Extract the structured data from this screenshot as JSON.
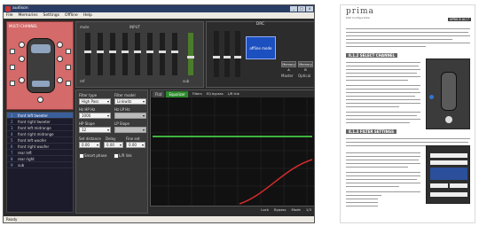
{
  "app": {
    "title": "audison",
    "menu": [
      "File",
      "Memories",
      "Settings",
      "Offline",
      "Help"
    ],
    "winbtns": [
      "_",
      "□",
      "x"
    ],
    "carpanel_header": "MULTI CHANNEL",
    "status": "Ready",
    "channels": [
      {
        "num": "1",
        "label": "front left tweeter"
      },
      {
        "num": "2",
        "label": "front right tweeter"
      },
      {
        "num": "3",
        "label": "front left midrange"
      },
      {
        "num": "4",
        "label": "front right midrange"
      },
      {
        "num": "5",
        "label": "front left woofer"
      },
      {
        "num": "6",
        "label": "front right woofer"
      },
      {
        "num": "7",
        "label": "rear left"
      },
      {
        "num": "8",
        "label": "rear right"
      },
      {
        "num": "9",
        "label": "sub"
      }
    ],
    "top": {
      "mute_label": "mute",
      "input_label": "INPUT",
      "sub_label": "sub",
      "ref_label": "ref",
      "mute2_label": "mute"
    },
    "dsp": {
      "title": "DRC",
      "screen_text": "offline mode",
      "memory_a": "Memory A",
      "memory_b": "Memory B",
      "master_label": "Master",
      "optical_label": "Optical"
    },
    "filters": {
      "filter_type_label": "Filter type",
      "filter_type_value": "High Pass",
      "filter_model_label": "Filter model",
      "filter_model_value": "Linkwitz",
      "hp_freq_label": "Hz HP Hz",
      "hp_freq_value": "1000",
      "lp_freq_label": "Hz LP Hz",
      "hp_slope_label": "HP Slope",
      "hp_slope_value": "12",
      "lp_slope_label": "LP Slope",
      "set_distance_label": "Set distance",
      "delay_label": "Delay",
      "fine_set_label": "Fine set",
      "distance_value": "0.00",
      "delay_value": "0.00",
      "fine_value": "0.00",
      "smart_phase_label": "Smart phase",
      "lr_link_label": "L/R link"
    },
    "graph": {
      "tabs": [
        "Flat",
        "Equalizer"
      ],
      "options": [
        "Filters",
        "EQ bypass",
        "L/R link"
      ],
      "bottom": [
        "Lock",
        "Bypass",
        "Mode",
        "1/3"
      ]
    }
  },
  "manual": {
    "logo": "prima",
    "logo_sub": "DSP Configuration",
    "header_tag": "APBX 8 AU.7",
    "section1": "8.1.2 SELECT CHANNEL",
    "section2": "8.1.3 FILTER SETTINGS"
  }
}
